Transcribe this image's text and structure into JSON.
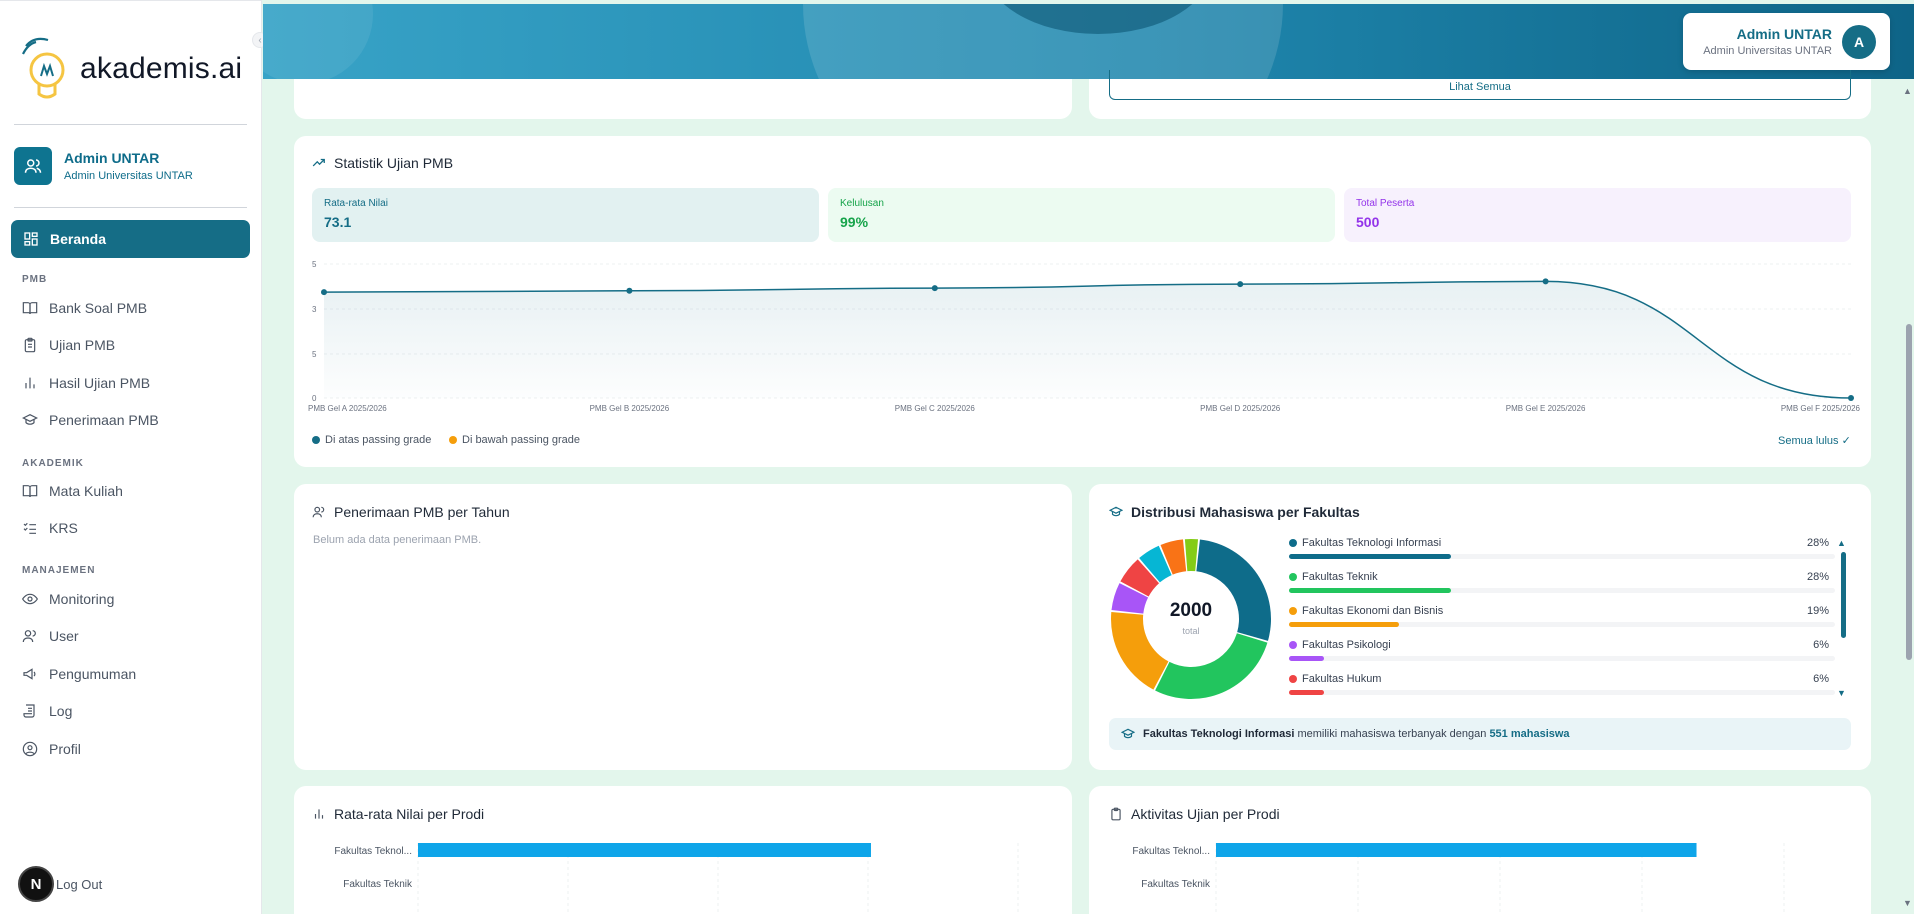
{
  "sidebar": {
    "logo_text": "akademis.ai",
    "collapse_icon": "‹",
    "user": {
      "name": "Admin UNTAR",
      "role": "Admin Universitas UNTAR"
    },
    "active_item": "Beranda",
    "sections": {
      "pmb": "PMB",
      "akademik": "AKADEMIK",
      "manajemen": "MANAJEMEN"
    },
    "items": {
      "bank_soal": "Bank Soal PMB",
      "ujian": "Ujian PMB",
      "hasil": "Hasil Ujian PMB",
      "penerimaan": "Penerimaan PMB",
      "mata_kuliah": "Mata Kuliah",
      "krs": "KRS",
      "monitoring": "Monitoring",
      "user": "User",
      "pengumuman": "Pengumuman",
      "log": "Log",
      "profil": "Profil"
    },
    "logout": "Log Out",
    "badge": "N"
  },
  "header": {
    "user_name": "Admin UNTAR",
    "user_role": "Admin Universitas UNTAR",
    "avatar_letter": "A"
  },
  "top_card": {
    "lihat_semua": "Lihat Semua"
  },
  "statistik": {
    "title": "Statistik Ujian PMB",
    "stats": [
      {
        "label": "Rata-rata Nilai",
        "value": "73.1",
        "color": "#156d86"
      },
      {
        "label": "Kelulusan",
        "value": "99%",
        "color": "#16a34a"
      },
      {
        "label": "Total Peserta",
        "value": "500",
        "color": "#9333ea"
      }
    ],
    "legend_above": "Di atas passing grade",
    "legend_below": "Di bawah passing grade",
    "status": "Semua lulus ✓"
  },
  "chart_data": [
    {
      "type": "line",
      "categories": [
        "PMB Gel A 2025/2026",
        "PMB Gel B 2025/2026",
        "PMB Gel C 2025/2026",
        "PMB Gel D 2025/2026",
        "PMB Gel E 2025/2026",
        "PMB Gel F 2025/2026"
      ],
      "series": [
        {
          "values": [
            79,
            80,
            82,
            85,
            87,
            0
          ]
        }
      ],
      "y_tick_labels": [
        "5",
        "3",
        "5",
        "0"
      ],
      "ylim": [
        0,
        100
      ],
      "color": "#156d86"
    },
    {
      "type": "pie",
      "center_value": "2000",
      "center_label": "total",
      "slices": [
        {
          "name": "Fakultas Teknologi Informasi",
          "pct": 28,
          "color": "#0e6c8a"
        },
        {
          "name": "Fakultas Teknik",
          "pct": 28,
          "color": "#22c55e"
        },
        {
          "name": "Fakultas Ekonomi dan Bisnis",
          "pct": 19,
          "color": "#f59e0b"
        },
        {
          "name": "Fakultas Psikologi",
          "pct": 6,
          "color": "#a855f7"
        },
        {
          "name": "Fakultas Hukum",
          "pct": 6,
          "color": "#ef4444"
        },
        {
          "name": "",
          "pct": 5,
          "color": "#06b6d4"
        },
        {
          "name": "",
          "pct": 5,
          "color": "#f97316"
        },
        {
          "name": "",
          "pct": 3,
          "color": "#84cc16"
        }
      ]
    },
    {
      "type": "bar",
      "categories": [
        "Fakultas Teknol...",
        "Fakultas Teknik"
      ],
      "values": [
        355,
        0
      ]
    },
    {
      "type": "bar",
      "categories": [
        "Fakultas Teknol...",
        "Fakultas Teknik"
      ],
      "values": [
        410,
        0
      ]
    }
  ],
  "penerimaan": {
    "title": "Penerimaan PMB per Tahun",
    "empty": "Belum ada data penerimaan PMB."
  },
  "distribusi": {
    "title": "Distribusi Mahasiswa per Fakultas",
    "faculties": [
      {
        "name": "Fakultas Teknologi Informasi",
        "pct_label": "28%",
        "pct": 28,
        "color": "#0e6c8a"
      },
      {
        "name": "Fakultas Teknik",
        "pct_label": "28%",
        "pct": 28,
        "color": "#22c55e"
      },
      {
        "name": "Fakultas Ekonomi dan Bisnis",
        "pct_label": "19%",
        "pct": 19,
        "color": "#f59e0b"
      },
      {
        "name": "Fakultas Psikologi",
        "pct_label": "6%",
        "pct": 6,
        "color": "#a855f7"
      },
      {
        "name": "Fakultas Hukum",
        "pct_label": "6%",
        "pct": 6,
        "color": "#ef4444"
      }
    ],
    "info_faculty": "Fakultas Teknologi Informasi",
    "info_mid": " memiliki mahasiswa terbanyak dengan ",
    "info_count": "551 mahasiswa"
  },
  "rata_prodi": {
    "title": "Rata-rata Nilai per Prodi"
  },
  "aktivitas_prodi": {
    "title": "Aktivitas Ujian per Prodi"
  }
}
